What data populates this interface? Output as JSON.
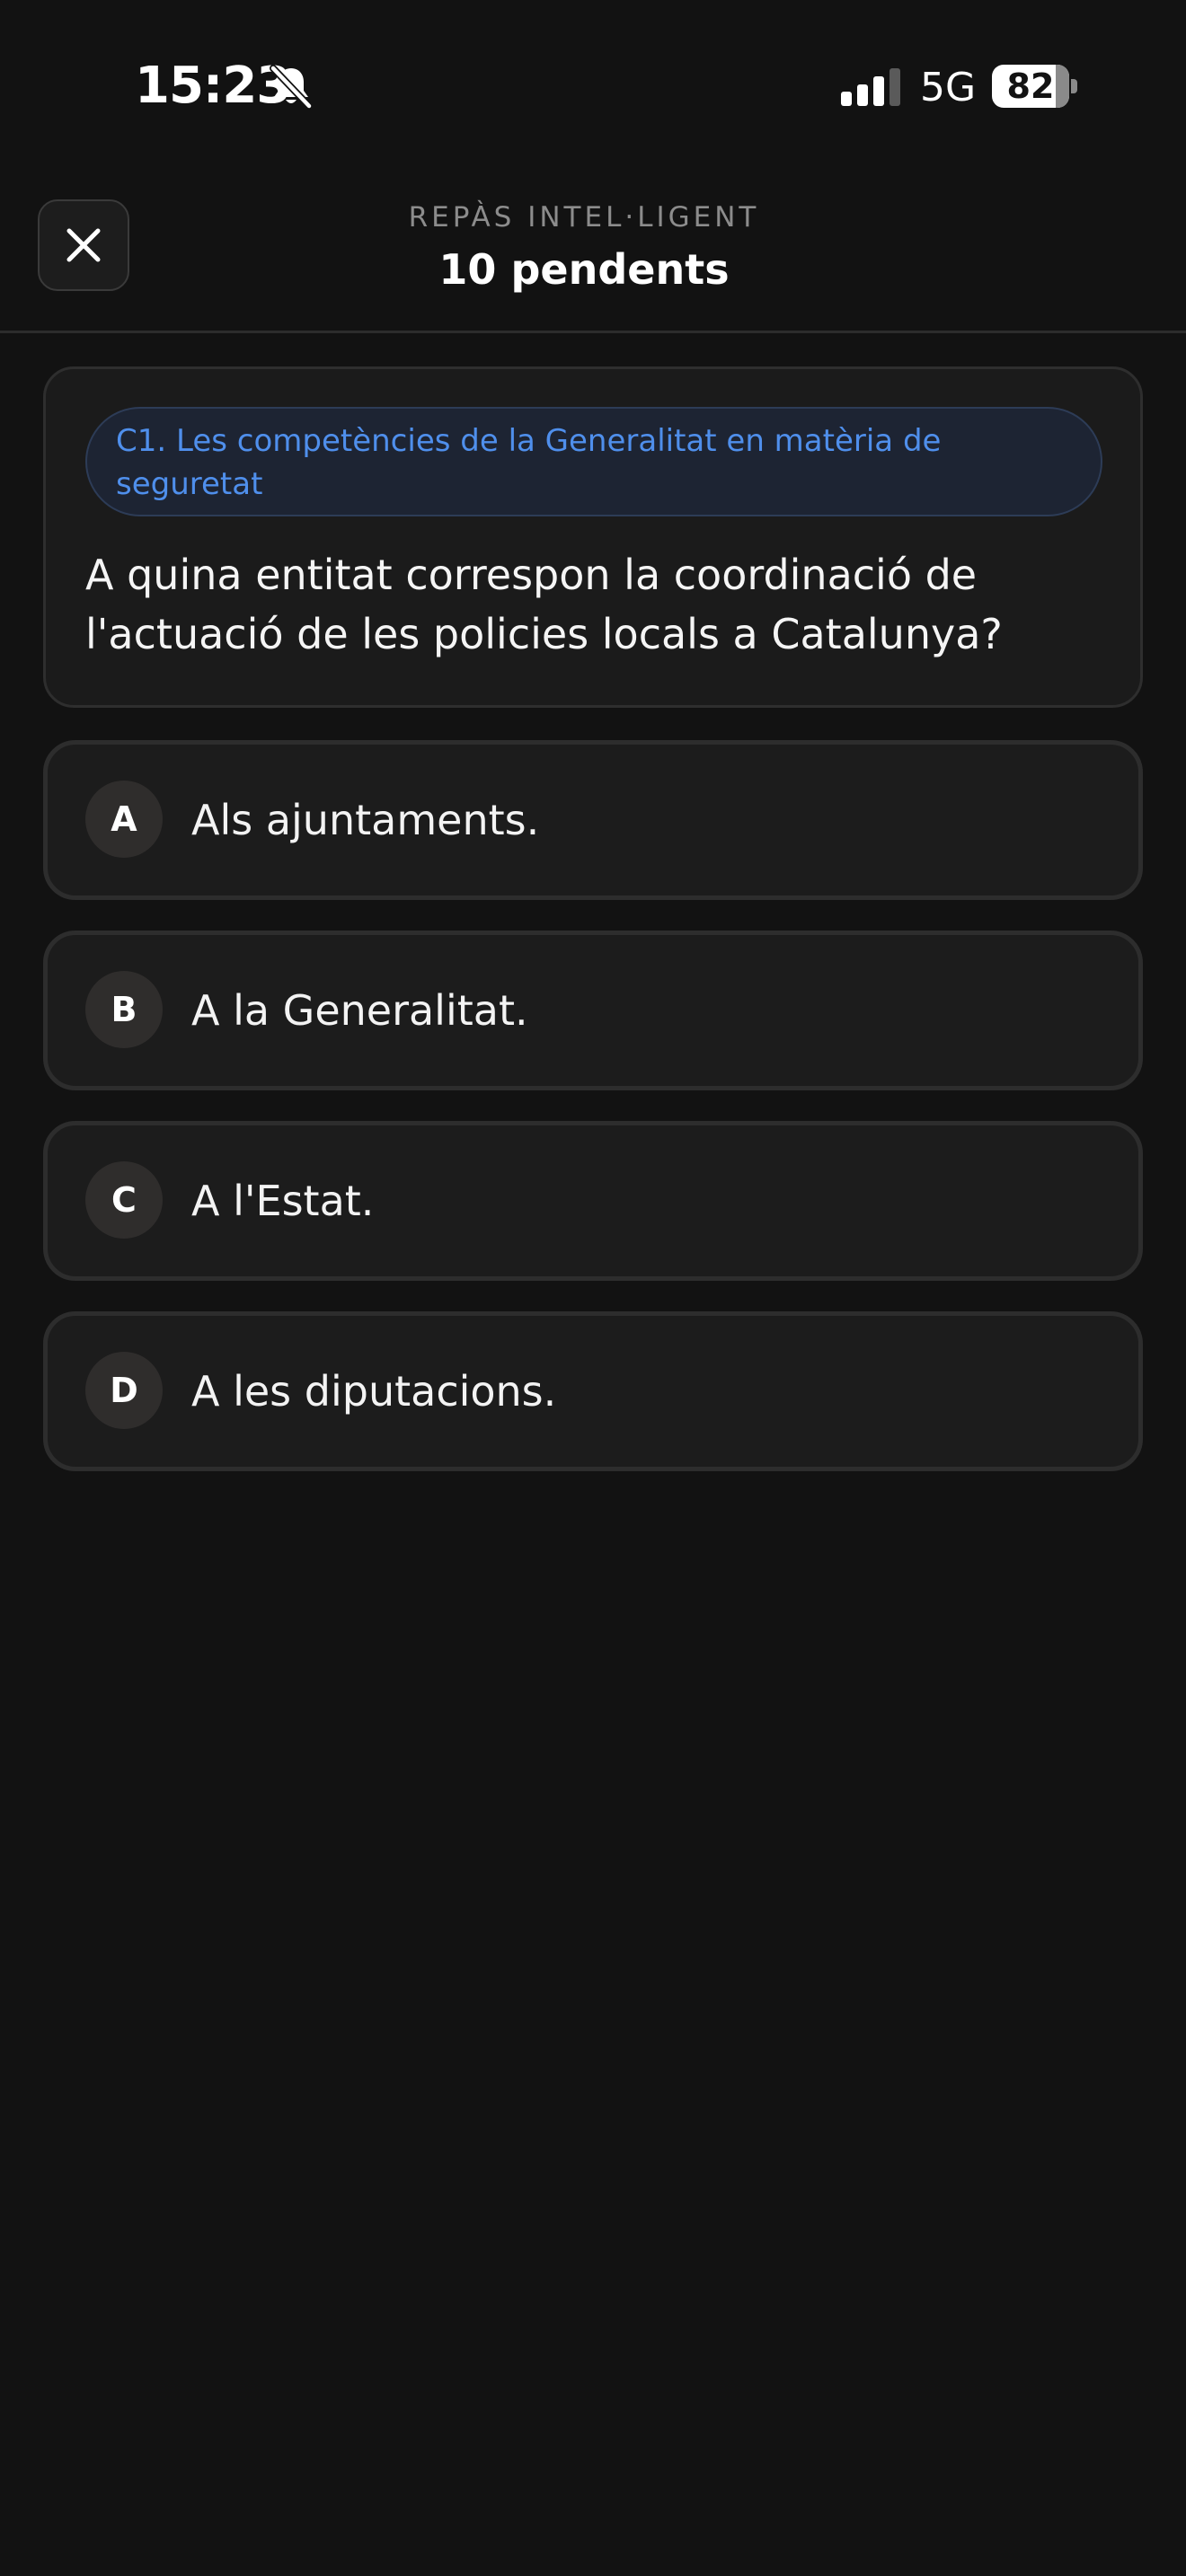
{
  "status_bar": {
    "time": "15:23",
    "network": "5G",
    "battery": "82",
    "battery_fraction": 0.82,
    "icons": [
      "bell-slash-icon",
      "signal-icon",
      "battery-icon"
    ]
  },
  "header": {
    "close_icon": "close-icon",
    "subtitle": "REPÀS INTEL·LIGENT",
    "title": "10 pendents"
  },
  "question": {
    "topic": "C1. Les competències de la Generalitat en matèria de seguretat",
    "text": "A quina entitat correspon la coordinació de l'actuació de les policies locals a Catalunya?"
  },
  "answers": [
    {
      "letter": "A",
      "text": "Als ajuntaments."
    },
    {
      "letter": "B",
      "text": "A la Generalitat."
    },
    {
      "letter": "C",
      "text": "A l'Estat."
    },
    {
      "letter": "D",
      "text": "A les diputacions."
    }
  ],
  "colors": {
    "background": "#121212",
    "card": "#1b1b1b",
    "accent": "#4f8fec",
    "muted_text": "#8c8c8c"
  }
}
